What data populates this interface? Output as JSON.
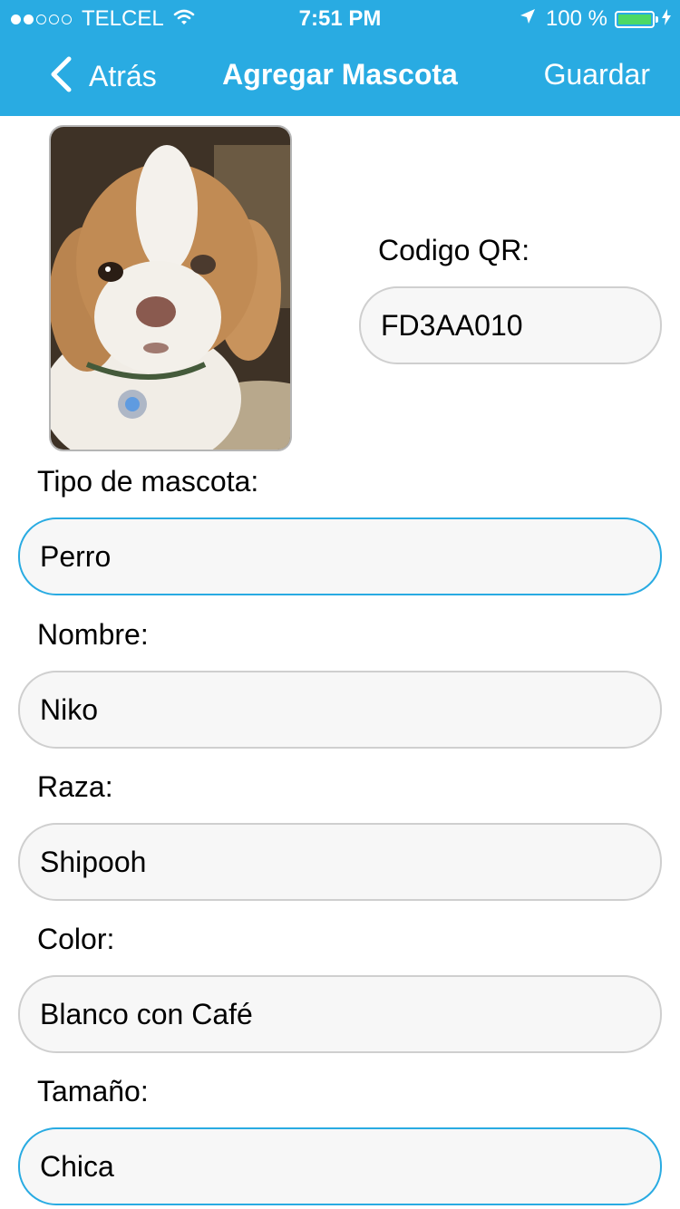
{
  "status_bar": {
    "signal_full": 2,
    "signal_total": 5,
    "carrier": "TELCEL",
    "time": "7:51 PM",
    "battery_text": "100 %",
    "battery_level": 1.0
  },
  "nav": {
    "back_label": "Atrás",
    "title": "Agregar Mascota",
    "save_label": "Guardar"
  },
  "colors": {
    "accent": "#29abe2",
    "battery": "#4cd964",
    "field_bg": "#f7f7f7",
    "field_border": "#cfcfcf"
  },
  "pet_photo": {
    "alt": ""
  },
  "form": {
    "qr": {
      "label": "Codigo QR:",
      "value": "FD3AA010"
    },
    "type": {
      "label": "Tipo de mascota:",
      "value": "Perro"
    },
    "name": {
      "label": "Nombre:",
      "value": "Niko"
    },
    "breed": {
      "label": "Raza:",
      "value": "Shipooh"
    },
    "color": {
      "label": "Color:",
      "value": "Blanco con Café"
    },
    "size": {
      "label": "Tamaño:",
      "value": "Chica"
    }
  }
}
